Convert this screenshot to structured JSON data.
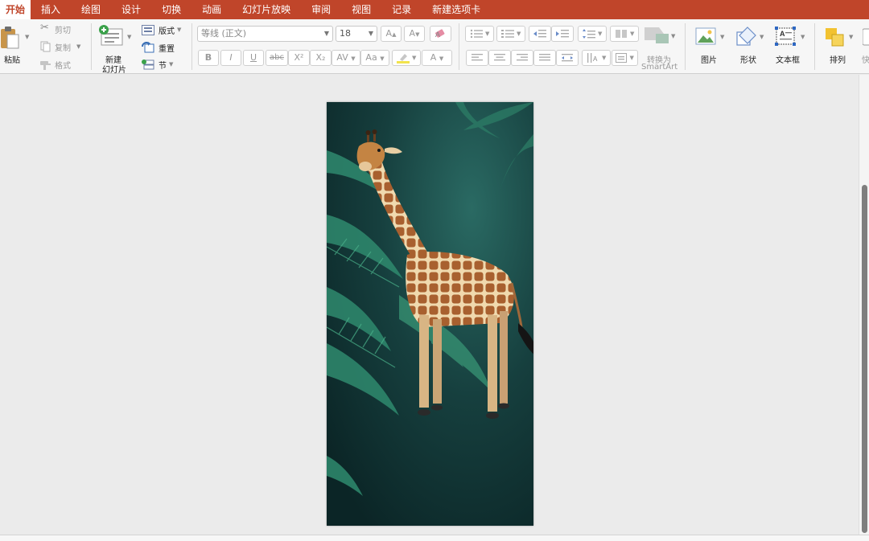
{
  "tabs": [
    "开始",
    "插入",
    "绘图",
    "设计",
    "切换",
    "动画",
    "幻灯片放映",
    "审阅",
    "视图",
    "记录",
    "新建选项卡"
  ],
  "clipboard": {
    "paste": "粘贴",
    "cut": "剪切",
    "copy": "复制",
    "format": "格式"
  },
  "slides": {
    "new_slide_line1": "新建",
    "new_slide_line2": "幻灯片",
    "layout": "版式",
    "reset": "重置",
    "section": "节"
  },
  "font": {
    "name": "等线 (正文)",
    "size": "18",
    "grow": "A",
    "shrink": "A",
    "bold": "B",
    "italic": "I",
    "underline": "U",
    "strike": "abc",
    "superscript": "X²",
    "subscript": "X₂",
    "spacing": "AV",
    "case": "Aa",
    "color": "A"
  },
  "paragraph": {
    "smartart_line1": "转换为",
    "smartart_line2": "SmartArt"
  },
  "insert": {
    "picture": "图片",
    "shapes": "形状",
    "textbox": "文本框"
  },
  "arrange": {
    "arrange": "排列",
    "quick": "快"
  },
  "colors": {
    "accent": "#c0452a"
  }
}
